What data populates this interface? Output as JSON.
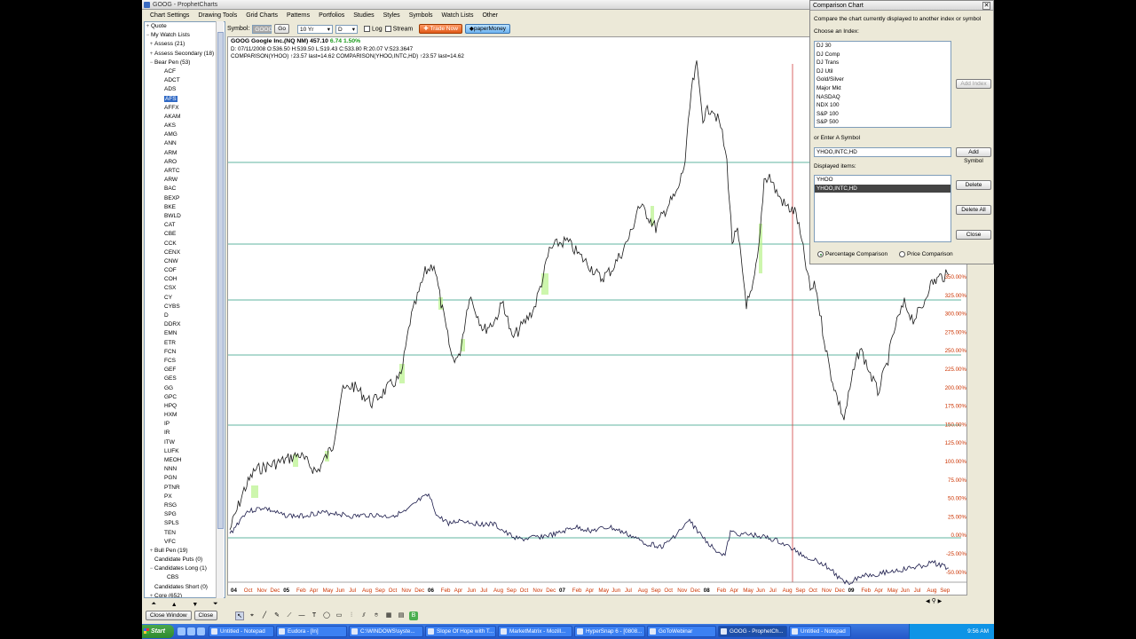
{
  "window": {
    "title": "GOOG - ProphetCharts"
  },
  "menu": [
    "Chart Settings",
    "Drawing Tools",
    "Grid Charts",
    "Patterns",
    "Portfolios",
    "Studies",
    "Styles",
    "Symbols",
    "Watch Lists",
    "Other"
  ],
  "sidebar": {
    "quote_label": "Quote",
    "watchlists_label": "My Watch Lists",
    "groups_top": [
      {
        "toggle": "+",
        "label": "Assess (21)"
      },
      {
        "toggle": "+",
        "label": "Assess Secondary (18)"
      },
      {
        "toggle": "−",
        "label": "Bear Pen (53)"
      }
    ],
    "bear_symbols": [
      "ACF",
      "ADCT",
      "ADS",
      "AFS",
      "AFFX",
      "AKAM",
      "AKS",
      "AMG",
      "ANN",
      "ARM",
      "ARO",
      "ARTC",
      "ARW",
      "BAC",
      "BEXP",
      "BKE",
      "BWLD",
      "CAT",
      "CBE",
      "CCK",
      "CENX",
      "CNW",
      "COF",
      "COH",
      "CSX",
      "CY",
      "CYBS",
      "D",
      "DDRX",
      "EMN",
      "ETR",
      "FCN",
      "FCS",
      "GEF",
      "GES",
      "GG",
      "GPC",
      "HPQ",
      "HXM",
      "IP",
      "IR",
      "ITW",
      "LUFK",
      "MEOH",
      "NNN",
      "PGN",
      "PTNR",
      "PX",
      "RSG",
      "SPG",
      "SPLS",
      "TEN",
      "VFC"
    ],
    "selected_symbol": "AFS",
    "groups_bottom": [
      {
        "toggle": "+",
        "label": "Bull Pen (19)"
      },
      {
        "toggle": "",
        "label": "Candidate Puts (0)"
      },
      {
        "toggle": "−",
        "label": "Candidates Long (1)"
      },
      {
        "toggle": "",
        "label": "CBS",
        "child": true
      },
      {
        "toggle": "",
        "label": "Candidates Short (0)"
      },
      {
        "toggle": "+",
        "label": "Core (652)"
      }
    ],
    "close_window": "Close Window",
    "close": "Close"
  },
  "toolbar": {
    "symbol_label": "Symbol:",
    "symbol_value": "GOOG",
    "go": "Go",
    "period": "10 Yr",
    "interval": "D",
    "log": "Log",
    "stream": "Stream",
    "trade_now": "Trade Now",
    "paper_money": "paperMoney"
  },
  "chart": {
    "header_symbol": "GOOG Google Inc.(NQ NM)",
    "header_price": "457.10",
    "header_change": "6.74",
    "header_pct": "1.50%",
    "info_line": "D: 07/11/2008 O:536.50 H:539.50 L:519.43 C:533.80 R:20.07 V:523.3647",
    "compare_line": "COMPARISON(YHOO) ↑23.57 last=14.62 COMPARISON(YHOO,INTC,HD) ↑23.57 last=14.62",
    "right_axis": [
      "350.00%",
      "325.00%",
      "300.00%",
      "275.00%",
      "250.00%",
      "225.00%",
      "200.00%",
      "175.00%",
      "150.00%",
      "125.00%",
      "100.00%",
      "75.00%",
      "50.00%",
      "25.00%",
      "0.00%",
      "-25.00%",
      "-50.00%"
    ],
    "bottom_axis": [
      {
        "t": "04",
        "b": true
      },
      {
        "t": "Oct"
      },
      {
        "t": "Nov"
      },
      {
        "t": "Dec"
      },
      {
        "t": "05",
        "b": true
      },
      {
        "t": "Feb"
      },
      {
        "t": "Apr"
      },
      {
        "t": "May"
      },
      {
        "t": "Jun"
      },
      {
        "t": "Jul"
      },
      {
        "t": "Aug"
      },
      {
        "t": "Sep"
      },
      {
        "t": "Oct"
      },
      {
        "t": "Nov"
      },
      {
        "t": "Dec"
      },
      {
        "t": "06",
        "b": true
      },
      {
        "t": "Feb"
      },
      {
        "t": "Apr"
      },
      {
        "t": "Jun"
      },
      {
        "t": "Jul"
      },
      {
        "t": "Aug"
      },
      {
        "t": "Sep"
      },
      {
        "t": "Oct"
      },
      {
        "t": "Nov"
      },
      {
        "t": "Dec"
      },
      {
        "t": "07",
        "b": true
      },
      {
        "t": "Feb"
      },
      {
        "t": "Apr"
      },
      {
        "t": "May"
      },
      {
        "t": "Jun"
      },
      {
        "t": "Jul"
      },
      {
        "t": "Aug"
      },
      {
        "t": "Sep"
      },
      {
        "t": "Oct"
      },
      {
        "t": "Nov"
      },
      {
        "t": "Dec"
      },
      {
        "t": "08",
        "b": true
      },
      {
        "t": "Feb"
      },
      {
        "t": "Apr"
      },
      {
        "t": "May"
      },
      {
        "t": "Jun"
      },
      {
        "t": "Jul"
      },
      {
        "t": "Aug"
      },
      {
        "t": "Sep"
      },
      {
        "t": "Oct"
      },
      {
        "t": "Nov"
      },
      {
        "t": "Dec"
      },
      {
        "t": "09",
        "b": true
      },
      {
        "t": "Feb"
      },
      {
        "t": "Apr"
      },
      {
        "t": "May"
      },
      {
        "t": "Jun"
      },
      {
        "t": "Jul"
      },
      {
        "t": "Aug"
      },
      {
        "t": "Sep"
      }
    ],
    "colors": {
      "price": "#1a1a1a",
      "comparison": "#1a1a4a",
      "gridline": "#2e9e80",
      "volume": "#b8f28a",
      "cursor": "#d04040",
      "axis_text": "#cc3300"
    }
  },
  "comparison": {
    "title": "Comparison Chart",
    "intro": "Compare the chart currently displayed to another index or symbol",
    "choose_index": "Choose an Index:",
    "indexes": [
      "DJ 30",
      "DJ Comp",
      "DJ Trans",
      "DJ Util",
      "Gold/Silver",
      "Major Mkt",
      "NASDAQ",
      "NDX 100",
      "S&P 100",
      "S&P 500"
    ],
    "add_index": "Add Index",
    "enter_symbol": "or Enter A Symbol",
    "symbol_value": "YHOO,INTC,HD",
    "add_symbol": "Add Symbol",
    "displayed_label": "Displayed items:",
    "displayed": [
      "YHOO",
      "YHOO,INTC,HD"
    ],
    "delete": "Delete",
    "delete_all": "Delete All",
    "close": "Close",
    "pct_comparison": "Percentage Comparison",
    "price_comparison": "Price Comparison"
  },
  "taskbar": {
    "start": "Start",
    "tasks": [
      {
        "label": "Untitled - Notepad",
        "w": 74
      },
      {
        "label": "Eudora - [In]",
        "w": 80
      },
      {
        "label": "C:\\WINDOWS\\syste...",
        "w": 84
      },
      {
        "label": "Slope Of Hope with T...",
        "w": 80
      },
      {
        "label": "MarketMatrix - Mozill...",
        "w": 84
      },
      {
        "label": "HyperSnap 6 - [0808...",
        "w": 80
      },
      {
        "label": "GoToWebinar",
        "w": 78
      },
      {
        "label": "GOOG - ProphetCh...",
        "w": 78,
        "active": true
      },
      {
        "label": "Untitled - Notepad",
        "w": 70
      }
    ],
    "clock": "9:56 AM"
  }
}
